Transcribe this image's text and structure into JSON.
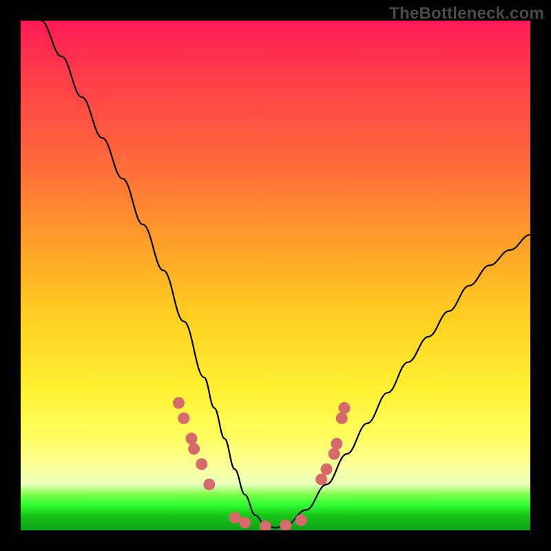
{
  "attribution": "TheBottleneck.com",
  "chart_data": {
    "type": "line",
    "title": "",
    "xlabel": "",
    "ylabel": "",
    "xlim": [
      0,
      100
    ],
    "ylim": [
      0,
      100
    ],
    "series": [
      {
        "name": "bottleneck-curve",
        "x": [
          4,
          8,
          12,
          16,
          20,
          24,
          28,
          32,
          36,
          38,
          40,
          42,
          44,
          46,
          48,
          50,
          52,
          56,
          60,
          64,
          68,
          72,
          76,
          80,
          84,
          88,
          92,
          96,
          100
        ],
        "y": [
          100,
          93,
          85,
          77,
          69,
          60,
          51,
          41,
          30,
          24,
          18,
          12,
          7,
          3,
          1,
          0.5,
          1,
          4,
          9,
          15,
          21,
          27,
          33,
          38,
          43,
          48,
          52,
          55,
          58
        ]
      }
    ],
    "markers": [
      {
        "group": "left",
        "x": 31,
        "y": 25
      },
      {
        "group": "left",
        "x": 32,
        "y": 22
      },
      {
        "group": "left",
        "x": 33.5,
        "y": 18
      },
      {
        "group": "left",
        "x": 34,
        "y": 16
      },
      {
        "group": "left",
        "x": 35.5,
        "y": 13
      },
      {
        "group": "left",
        "x": 37,
        "y": 9
      },
      {
        "group": "bottom",
        "x": 42,
        "y": 2.5
      },
      {
        "group": "bottom",
        "x": 44,
        "y": 1.5
      },
      {
        "group": "bottom",
        "x": 48,
        "y": 0.8
      },
      {
        "group": "bottom",
        "x": 52,
        "y": 1
      },
      {
        "group": "bottom",
        "x": 55,
        "y": 2
      },
      {
        "group": "right",
        "x": 59,
        "y": 10
      },
      {
        "group": "right",
        "x": 60,
        "y": 12
      },
      {
        "group": "right",
        "x": 61.5,
        "y": 15
      },
      {
        "group": "right",
        "x": 62,
        "y": 17
      },
      {
        "group": "right",
        "x": 63,
        "y": 22
      },
      {
        "group": "right",
        "x": 63.5,
        "y": 24
      }
    ]
  }
}
